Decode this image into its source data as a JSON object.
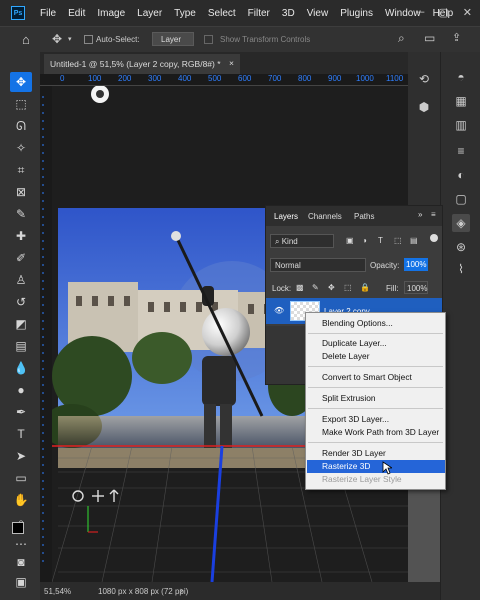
{
  "menubar": {
    "logo": "Ps",
    "items": [
      "File",
      "Edit",
      "Image",
      "Layer",
      "Type",
      "Select",
      "Filter",
      "3D",
      "View",
      "Plugins",
      "Window",
      "Help"
    ]
  },
  "options": {
    "auto_select_label": "Auto-Select:",
    "auto_select_target": "Layer",
    "show_transform": "Show Transform Controls"
  },
  "document": {
    "tab_title": "Untitled-1 @ 51,5% (Layer 2 copy, RGB/8#) *",
    "tab_close": "×"
  },
  "ruler": {
    "ticks": [
      "0",
      "100",
      "200",
      "300",
      "400",
      "500",
      "600",
      "700",
      "800",
      "900",
      "1000",
      "1100"
    ]
  },
  "status": {
    "zoom": "51,54%",
    "doc_info": "1080 px x 808 px (72 ppi)"
  },
  "layers_panel": {
    "tabs": [
      "Layers",
      "Channels",
      "Paths"
    ],
    "filter_kind": "Kind",
    "blend_mode": "Normal",
    "opacity_label": "Opacity:",
    "opacity_value": "100%",
    "lock_label": "Lock:",
    "fill_label": "Fill:",
    "fill_value": "100%",
    "layer_name": "Layer 2 copy"
  },
  "context_menu": {
    "items": [
      {
        "label": "Blending Options..."
      },
      {
        "label": "Duplicate Layer..."
      },
      {
        "label": "Delete Layer"
      },
      {
        "label": "Convert to Smart Object"
      },
      {
        "label": "Split Extrusion"
      },
      {
        "label": "Export 3D Layer..."
      },
      {
        "label": "Make Work Path from 3D Layer"
      },
      {
        "label": "Render 3D Layer"
      },
      {
        "label": "Rasterize 3D",
        "state": "highlighted"
      },
      {
        "label": "Rasterize Layer Style",
        "state": "disabled"
      }
    ]
  },
  "colors": {
    "accent": "#1473e6",
    "menu_highlight": "#2565d8",
    "guide_red": "#e02020",
    "guide_blue": "#1a3fe0"
  }
}
